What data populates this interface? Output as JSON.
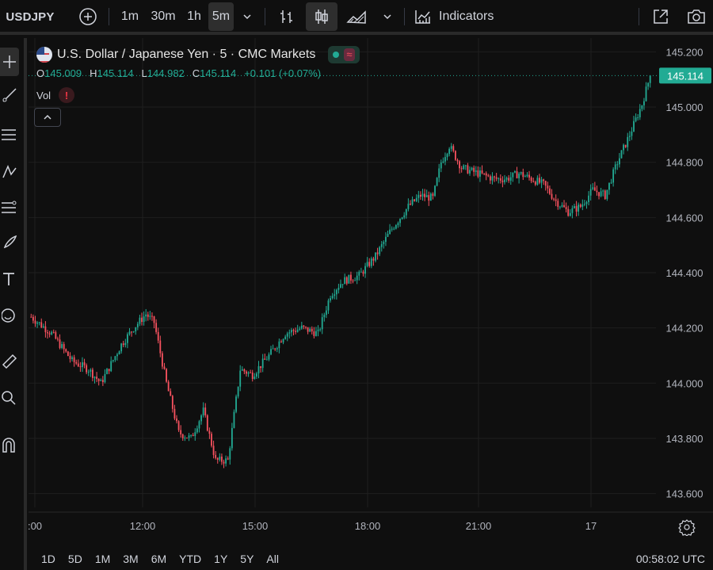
{
  "toolbar": {
    "symbol": "USDJPY",
    "intervals": [
      "1m",
      "30m",
      "1h",
      "5m"
    ],
    "active_interval": "5m",
    "indicators_label": "Indicators"
  },
  "legend": {
    "title": "U.S. Dollar / Japanese Yen · 5 · CMC Markets",
    "status_icon": "≈",
    "open_label": "O",
    "open": "145.009",
    "high_label": "H",
    "high": "145.114",
    "low_label": "L",
    "low": "144.982",
    "close_label": "C",
    "close": "145.114",
    "change": "+0.101 (+0.07%)",
    "vol_label": "Vol",
    "vol_warning": "!"
  },
  "price_axis": {
    "ticks": [
      "145.200",
      "145.000",
      "144.800",
      "144.600",
      "144.400",
      "144.200",
      "144.000",
      "143.800",
      "143.600"
    ],
    "last_price": "145.114"
  },
  "time_axis": {
    "ticks": [
      ":00",
      "12:00",
      "15:00",
      "18:00",
      "21:00",
      "17"
    ]
  },
  "ranges": [
    "1D",
    "5D",
    "1M",
    "3M",
    "6M",
    "YTD",
    "1Y",
    "5Y",
    "All"
  ],
  "clock": "00:58:02 UTC",
  "colors": {
    "up": "#22ab94",
    "down": "#f7525f",
    "background": "#0f0f0f",
    "grid": "#1f1f1f",
    "price_label_bg": "#22ab94"
  },
  "chart_data": {
    "type": "candlestick",
    "symbol": "USDJPY",
    "interval": "5",
    "ylim": [
      143.55,
      145.25
    ],
    "x_ticks": [
      ":00",
      "12:00",
      "15:00",
      "18:00",
      "21:00",
      "17"
    ],
    "anchor_path": [
      [
        0,
        144.24
      ],
      [
        10,
        144.18
      ],
      [
        20,
        144.08
      ],
      [
        28,
        144.05
      ],
      [
        34,
        144.0
      ],
      [
        44,
        144.14
      ],
      [
        50,
        144.2
      ],
      [
        56,
        144.25
      ],
      [
        60,
        144.22
      ],
      [
        66,
        144.0
      ],
      [
        72,
        143.82
      ],
      [
        78,
        143.8
      ],
      [
        84,
        143.9
      ],
      [
        90,
        143.72
      ],
      [
        96,
        143.72
      ],
      [
        102,
        144.05
      ],
      [
        108,
        144.03
      ],
      [
        116,
        144.1
      ],
      [
        124,
        144.18
      ],
      [
        132,
        144.2
      ],
      [
        140,
        144.18
      ],
      [
        146,
        144.32
      ],
      [
        152,
        144.37
      ],
      [
        160,
        144.39
      ],
      [
        168,
        144.46
      ],
      [
        176,
        144.56
      ],
      [
        184,
        144.64
      ],
      [
        190,
        144.68
      ],
      [
        196,
        144.67
      ],
      [
        200,
        144.8
      ],
      [
        204,
        144.86
      ],
      [
        210,
        144.78
      ],
      [
        218,
        144.76
      ],
      [
        226,
        144.74
      ],
      [
        232,
        144.74
      ],
      [
        238,
        144.76
      ],
      [
        244,
        144.74
      ],
      [
        250,
        144.72
      ],
      [
        256,
        144.66
      ],
      [
        262,
        144.62
      ],
      [
        268,
        144.64
      ],
      [
        274,
        144.7
      ],
      [
        280,
        144.68
      ],
      [
        286,
        144.8
      ],
      [
        292,
        144.9
      ],
      [
        298,
        145.01
      ],
      [
        302,
        145.114
      ]
    ]
  }
}
